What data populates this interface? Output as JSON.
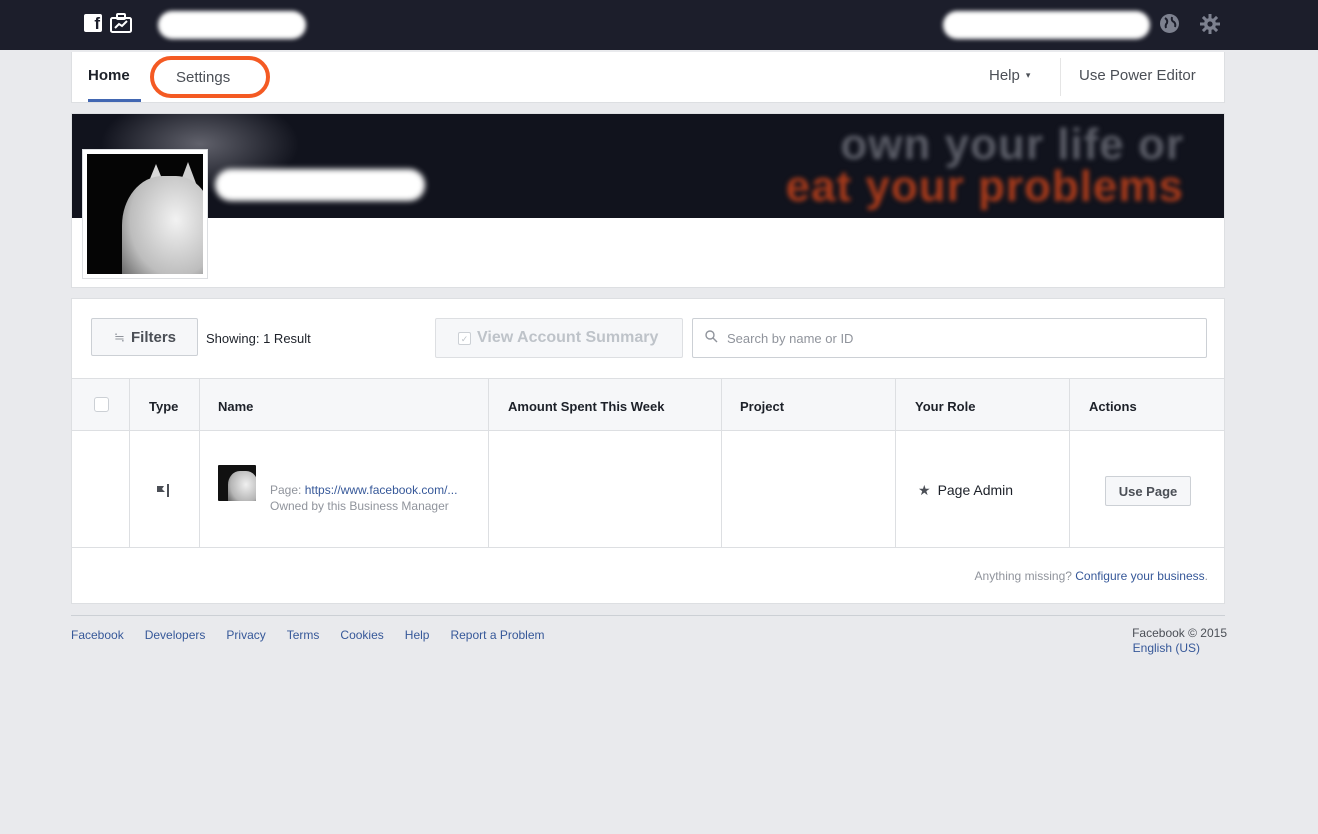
{
  "topbar": {
    "logo_letter": "f",
    "icons": [
      "facebook-logo-icon",
      "briefcase-icon",
      "globe-icon",
      "gear-icon"
    ]
  },
  "nav": {
    "home": "Home",
    "settings": "Settings",
    "help": "Help",
    "help_caret": "▾",
    "power_editor": "Use Power Editor"
  },
  "cover": {
    "line1": "own your life or",
    "line2": "eat your problems",
    "colors": {
      "accent_red": "#a53a1b",
      "dark_bg": "#11131d"
    }
  },
  "toolbar": {
    "filters_icon": "≒",
    "filters": "Filters",
    "showing": "Showing: 1 Result",
    "summary_check": "✓",
    "view_summary": "View Account Summary",
    "search_placeholder": "Search by name or ID"
  },
  "table": {
    "columns": [
      "Type",
      "Name",
      "Amount Spent This Week",
      "Project",
      "Your Role",
      "Actions"
    ],
    "rows": [
      {
        "type_icon": "flag-icon",
        "page_prefix": "Page: ",
        "page_url": "https://www.facebook.com/...",
        "owned": "Owned by this Business Manager",
        "amount": "",
        "project": "",
        "role_star": "★",
        "role": "Page Admin",
        "action": "Use Page"
      }
    ],
    "missing_prefix": "Anything missing? ",
    "missing_link": "Configure your business",
    "missing_suffix": "."
  },
  "footer": {
    "links": [
      "Facebook",
      "Developers",
      "Privacy",
      "Terms",
      "Cookies",
      "Help",
      "Report a Problem"
    ],
    "copyright": "Facebook © 2015",
    "language": "English (US)"
  },
  "colors": {
    "topbar": "#1c1e2b",
    "link": "#365899",
    "highlight_ring": "#f45a23",
    "active_tab": "#4267b2"
  }
}
